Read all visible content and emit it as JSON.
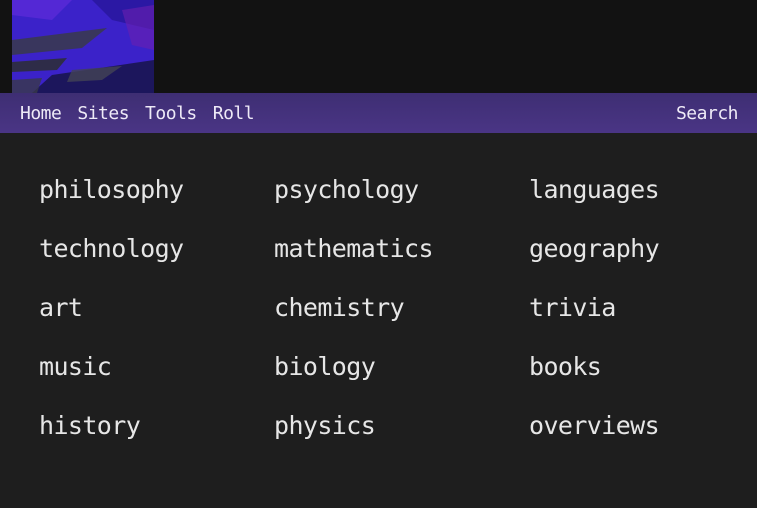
{
  "nav": {
    "links": [
      "Home",
      "Sites",
      "Tools",
      "Roll"
    ],
    "search_label": "Search"
  },
  "topics": {
    "columns": [
      [
        "philosophy",
        "technology",
        "art",
        "music",
        "history"
      ],
      [
        "psychology",
        "mathematics",
        "chemistry",
        "biology",
        "physics"
      ],
      [
        "languages",
        "geography",
        "trivia",
        "books",
        "overviews"
      ]
    ]
  },
  "colors": {
    "page_background": "#1e1e1e",
    "header_background": "#121212",
    "navbar_background": "#45327d",
    "text": "#e6e6e6"
  }
}
